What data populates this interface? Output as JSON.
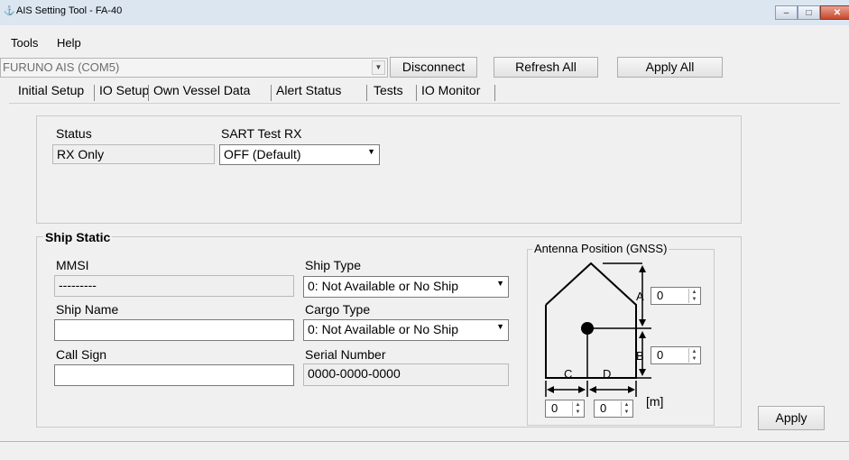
{
  "window": {
    "title": "AIS Setting Tool - FA-40",
    "icon": "app-icon"
  },
  "menu": [
    {
      "label": "Tools"
    },
    {
      "label": "Help"
    }
  ],
  "connection": {
    "device": "FURUNO AIS (COM5)",
    "disconnect_label": "Disconnect",
    "refresh_label": "Refresh All",
    "apply_all_label": "Apply All"
  },
  "tabs": [
    {
      "label": "Initial Setup"
    },
    {
      "label": "IO Setup"
    },
    {
      "label": "Own Vessel Data"
    },
    {
      "label": "Alert Status"
    },
    {
      "label": "Tests"
    },
    {
      "label": "IO Monitor"
    }
  ],
  "status_panel": {
    "status_label": "Status",
    "status_value": "RX Only",
    "sart_label": "SART Test RX",
    "sart_value": "OFF (Default)"
  },
  "ship_static": {
    "title": "Ship Static",
    "mmsi_label": "MMSI",
    "mmsi_value": "---------",
    "ship_name_label": "Ship Name",
    "ship_name_value": "",
    "call_sign_label": "Call Sign",
    "call_sign_value": "",
    "ship_type_label": "Ship Type",
    "ship_type_value": "0: Not Available or No Ship",
    "cargo_type_label": "Cargo Type",
    "cargo_type_value": "0: Not Available or No Ship",
    "serial_label": "Serial Number",
    "serial_value": "0000-0000-0000"
  },
  "antenna": {
    "title": "Antenna Position (GNSS)",
    "a_label": "A",
    "a_value": "0",
    "b_label": "B",
    "b_value": "0",
    "c_label": "C",
    "c_value": "0",
    "d_label": "D",
    "d_value": "0",
    "unit": "[m]"
  },
  "apply_label": "Apply"
}
